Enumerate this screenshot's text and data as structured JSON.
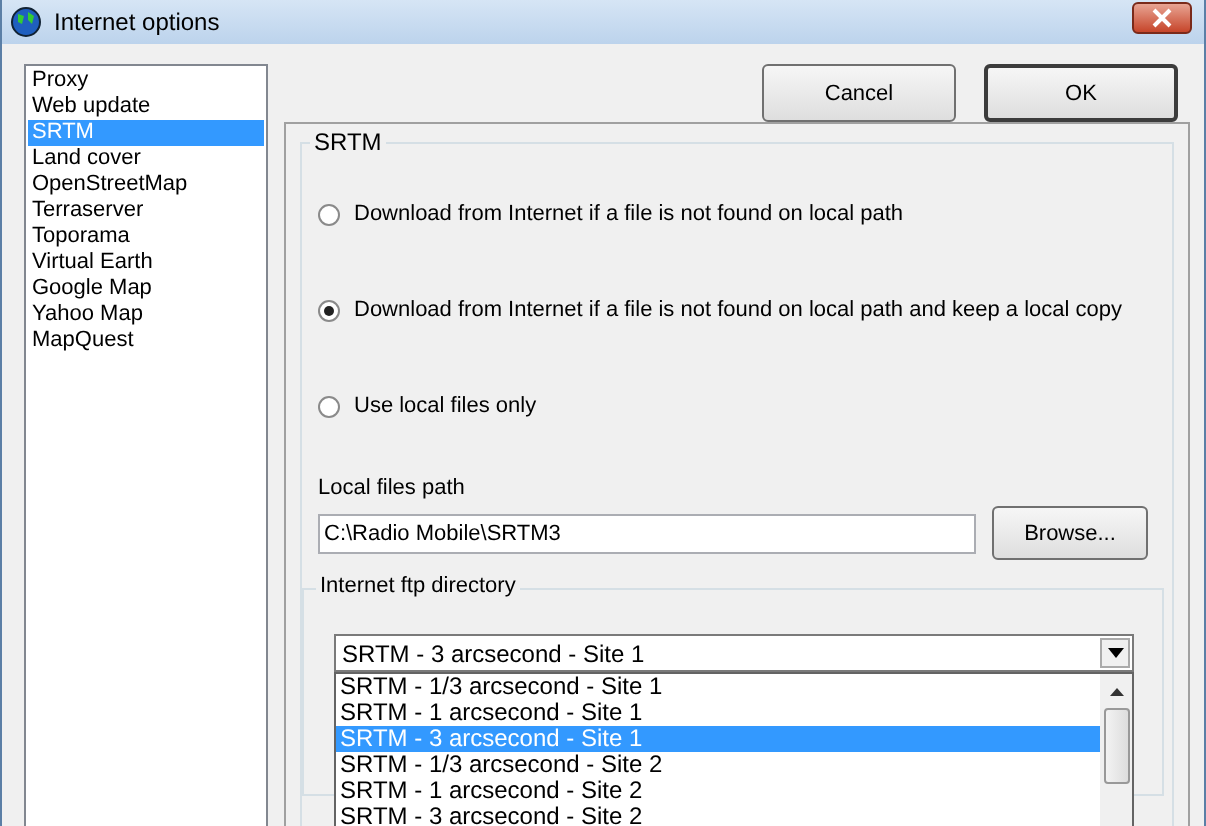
{
  "window": {
    "title": "Internet options"
  },
  "sidebar": {
    "items": [
      {
        "label": "Proxy",
        "selected": false
      },
      {
        "label": "Web update",
        "selected": false
      },
      {
        "label": "SRTM",
        "selected": true
      },
      {
        "label": "Land cover",
        "selected": false
      },
      {
        "label": "OpenStreetMap",
        "selected": false
      },
      {
        "label": "Terraserver",
        "selected": false
      },
      {
        "label": "Toporama",
        "selected": false
      },
      {
        "label": "Virtual Earth",
        "selected": false
      },
      {
        "label": "Google Map",
        "selected": false
      },
      {
        "label": "Yahoo Map",
        "selected": false
      },
      {
        "label": "MapQuest",
        "selected": false
      }
    ]
  },
  "buttons": [
    {
      "label": "Cancel",
      "default": false
    },
    {
      "label": "OK",
      "default": true
    }
  ],
  "srtm": {
    "title": "SRTM",
    "options": [
      {
        "label": "Download from Internet if a file is not found on local path",
        "selected": false
      },
      {
        "label": "Download from Internet if a file is not found on local path and keep a local copy",
        "selected": true
      },
      {
        "label": "Use local files only",
        "selected": false
      }
    ],
    "local_path": {
      "label": "Local files path",
      "value": "C:\\Radio Mobile\\SRTM3",
      "browse": "Browse..."
    },
    "ftp": {
      "title": "Internet ftp directory",
      "value": "SRTM - 3 arcsecond - Site 1",
      "options": [
        {
          "label": "SRTM - 1/3 arcsecond - Site 1",
          "selected": false
        },
        {
          "label": "SRTM - 1 arcsecond - Site 1",
          "selected": false
        },
        {
          "label": "SRTM - 3 arcsecond - Site 1",
          "selected": true
        },
        {
          "label": "SRTM - 1/3 arcsecond - Site 2",
          "selected": false
        },
        {
          "label": "SRTM - 1 arcsecond - Site 2",
          "selected": false
        },
        {
          "label": "SRTM - 3 arcsecond - Site 2",
          "selected": false
        }
      ]
    }
  }
}
